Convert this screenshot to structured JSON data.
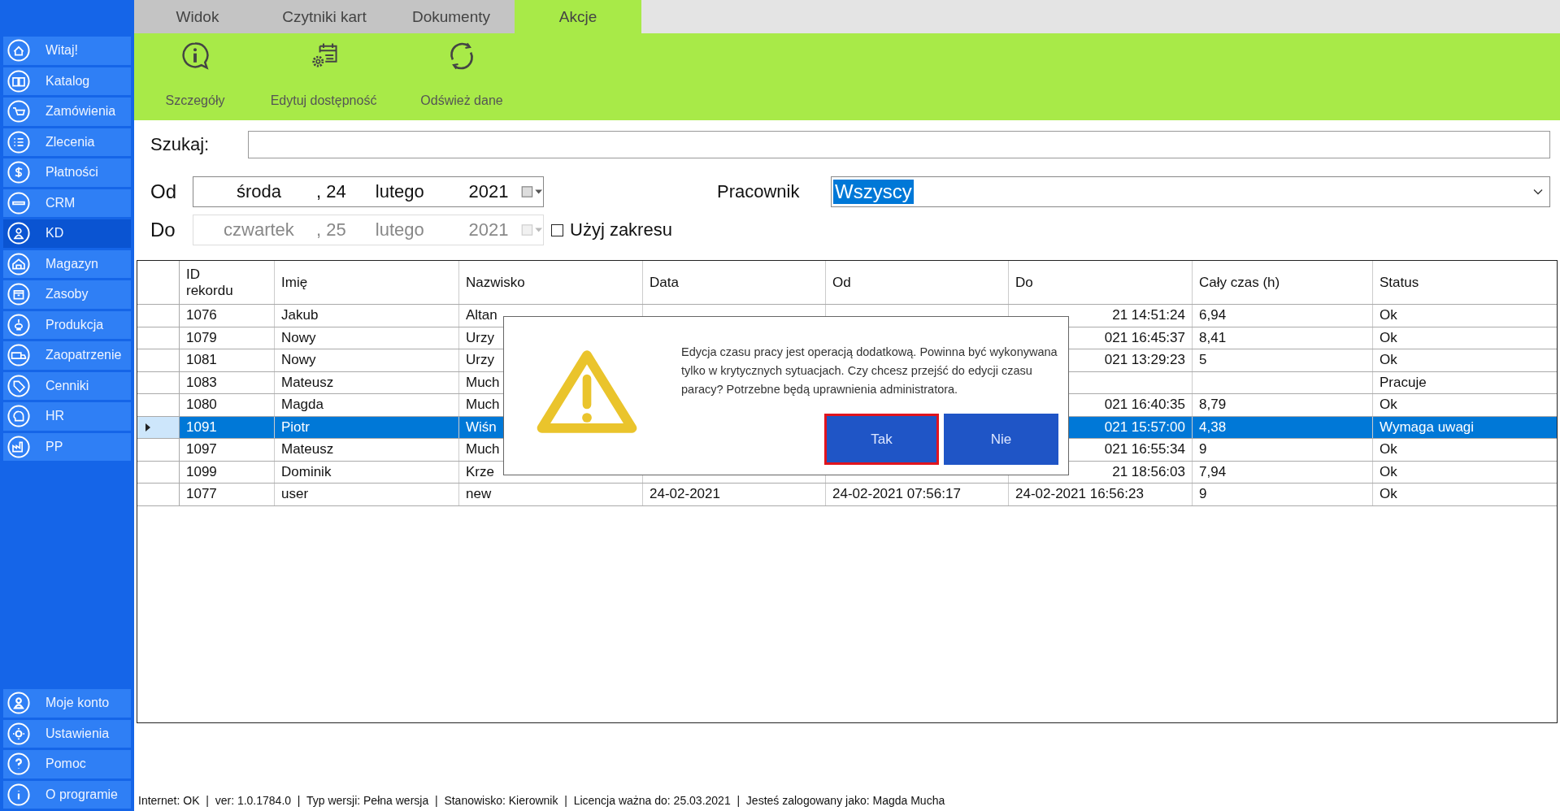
{
  "sidebar": {
    "items": [
      {
        "label": "Witaj!",
        "selected": false
      },
      {
        "label": "Katalog",
        "selected": false
      },
      {
        "label": "Zamówienia",
        "selected": false
      },
      {
        "label": "Zlecenia",
        "selected": false
      },
      {
        "label": "Płatności",
        "selected": false
      },
      {
        "label": "CRM",
        "selected": false
      },
      {
        "label": "KD",
        "selected": true
      },
      {
        "label": "Magazyn",
        "selected": false
      },
      {
        "label": "Zasoby",
        "selected": false
      },
      {
        "label": "Produkcja",
        "selected": false
      },
      {
        "label": "Zaopatrzenie",
        "selected": false
      },
      {
        "label": "Cenniki",
        "selected": false
      },
      {
        "label": "HR",
        "selected": false
      },
      {
        "label": "PP",
        "selected": false
      }
    ],
    "bottom_items": [
      "Moje konto",
      "Ustawienia",
      "Pomoc",
      "O programie"
    ]
  },
  "tabs": [
    {
      "label": "Widok",
      "selected": false
    },
    {
      "label": "Czytniki kart",
      "selected": false
    },
    {
      "label": "Dokumenty",
      "selected": false
    },
    {
      "label": "Akcje",
      "selected": true
    }
  ],
  "toolbar": [
    "Szczegóły",
    "Edytuj dostępność",
    "Odśwież dane"
  ],
  "search": {
    "label": "Szukaj:"
  },
  "date_from": {
    "label": "Od",
    "weekday": "środa",
    "day": ", 24",
    "month": "lutego",
    "year": "2021",
    "disabled": false
  },
  "date_to": {
    "label": "Do",
    "weekday": "czwartek",
    "day": ", 25",
    "month": "lutego",
    "year": "2021",
    "disabled": true
  },
  "range_checkbox": {
    "label": "Użyj zakresu",
    "checked": false
  },
  "employee": {
    "label": "Pracownik",
    "value": "Wszyscy"
  },
  "table": {
    "columns": [
      "ID\nrekordu",
      "Imię",
      "Nazwisko",
      "Data",
      "Od",
      "Do",
      "Cały czas (h)",
      "Status"
    ],
    "rows": [
      {
        "selected": false,
        "cells": [
          "1076",
          "Jakub",
          "Altan",
          null,
          null,
          {
            "text": "21 14:51:24",
            "clipped": true
          },
          "6,94",
          "Ok"
        ]
      },
      {
        "selected": false,
        "cells": [
          "1079",
          "Nowy",
          "Urzy",
          null,
          null,
          {
            "text": "021 16:45:37",
            "clipped": true
          },
          "8,41",
          "Ok"
        ]
      },
      {
        "selected": false,
        "cells": [
          "1081",
          "Nowy",
          "Urzy",
          null,
          null,
          {
            "text": "021 13:29:23",
            "clipped": true
          },
          "5",
          "Ok"
        ]
      },
      {
        "selected": false,
        "cells": [
          "1083",
          "Mateusz",
          "Much",
          null,
          null,
          null,
          null,
          "Pracuje"
        ]
      },
      {
        "selected": false,
        "cells": [
          "1080",
          "Magda",
          "Much",
          null,
          null,
          {
            "text": "021 16:40:35",
            "clipped": true
          },
          "8,79",
          "Ok"
        ]
      },
      {
        "selected": true,
        "cells": [
          "1091",
          "Piotr",
          "Wiśn",
          null,
          null,
          {
            "text": "021 15:57:00",
            "clipped": true
          },
          "4,38",
          "Wymaga uwagi"
        ]
      },
      {
        "selected": false,
        "cells": [
          "1097",
          "Mateusz",
          "Much",
          null,
          null,
          {
            "text": "021 16:55:34",
            "clipped": true
          },
          "9",
          "Ok"
        ]
      },
      {
        "selected": false,
        "cells": [
          "1099",
          "Dominik",
          "Krze",
          null,
          null,
          {
            "text": "21 18:56:03",
            "clipped": true
          },
          "7,94",
          "Ok"
        ]
      },
      {
        "selected": false,
        "cells": [
          "1077",
          "user",
          "new",
          "24-02-2021",
          "24-02-2021 07:56:17",
          "24-02-2021 16:56:23",
          "9",
          "Ok"
        ]
      }
    ]
  },
  "dialog": {
    "message": "Edycja czasu pracy jest operacją dodatkową. Powinna być wykonywana tylko w krytycznych sytuacjach. Czy chcesz przejść do edycji czasu paracy? Potrzebne będą uprawnienia administratora.",
    "buttons": [
      {
        "label": "Tak",
        "focused": true
      },
      {
        "label": "Nie",
        "focused": false
      }
    ]
  },
  "status_bar": "Internet: OK  |  ver: 1.0.1784.0  |  Typ wersji: Pełna wersja  |  Stanowisko: Kierownik  |  Licencja ważna do: 25.03.2021  |  Jesteś zalogowany jako: Magda Mucha"
}
